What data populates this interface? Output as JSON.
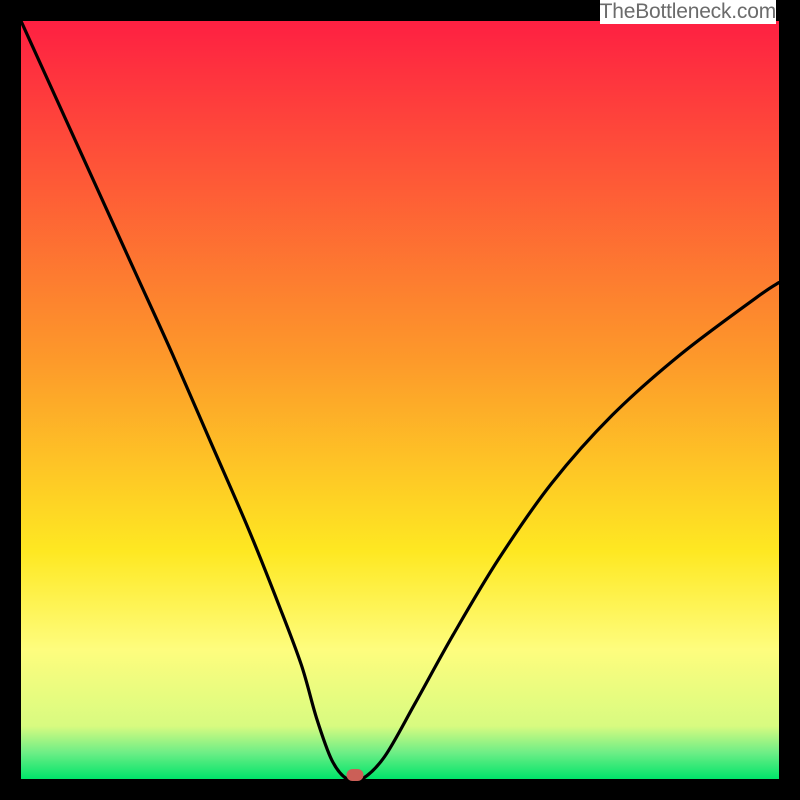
{
  "watermark": "TheBottleneck.com",
  "colors": {
    "gradient_top": "#FE2042",
    "gradient_mid_upper": "#FD8E2D",
    "gradient_mid": "#FEE421",
    "gradient_mid_lower": "#FEFD7C",
    "gradient_green_light": "#9BF58D",
    "gradient_green": "#00E46A",
    "curve": "#000000",
    "marker": "#CB5F57",
    "frame": "#000000"
  },
  "chart_data": {
    "type": "line",
    "title": "",
    "xlabel": "",
    "ylabel": "",
    "xlim": [
      0,
      100
    ],
    "ylim": [
      0,
      100
    ],
    "series": [
      {
        "name": "bottleneck-curve",
        "x": [
          0,
          5,
          10,
          15,
          20,
          25,
          30,
          34,
          37,
          39,
          41,
          43,
          45,
          48,
          52,
          57,
          63,
          70,
          78,
          87,
          97,
          100
        ],
        "y": [
          100,
          89,
          78,
          67,
          56,
          44.5,
          33,
          23,
          15,
          8,
          2.5,
          0,
          0,
          3,
          10,
          19,
          29,
          39,
          48,
          56,
          63.5,
          65.5
        ]
      }
    ],
    "marker": {
      "x": 44,
      "y": 0.5
    },
    "gradient_stops": [
      {
        "offset": 0.0,
        "color": "#FE2042"
      },
      {
        "offset": 0.45,
        "color": "#FD9A2A"
      },
      {
        "offset": 0.7,
        "color": "#FEE822"
      },
      {
        "offset": 0.83,
        "color": "#FEFD7E"
      },
      {
        "offset": 0.93,
        "color": "#D8FB80"
      },
      {
        "offset": 0.965,
        "color": "#6EEE86"
      },
      {
        "offset": 1.0,
        "color": "#00E46A"
      }
    ]
  }
}
